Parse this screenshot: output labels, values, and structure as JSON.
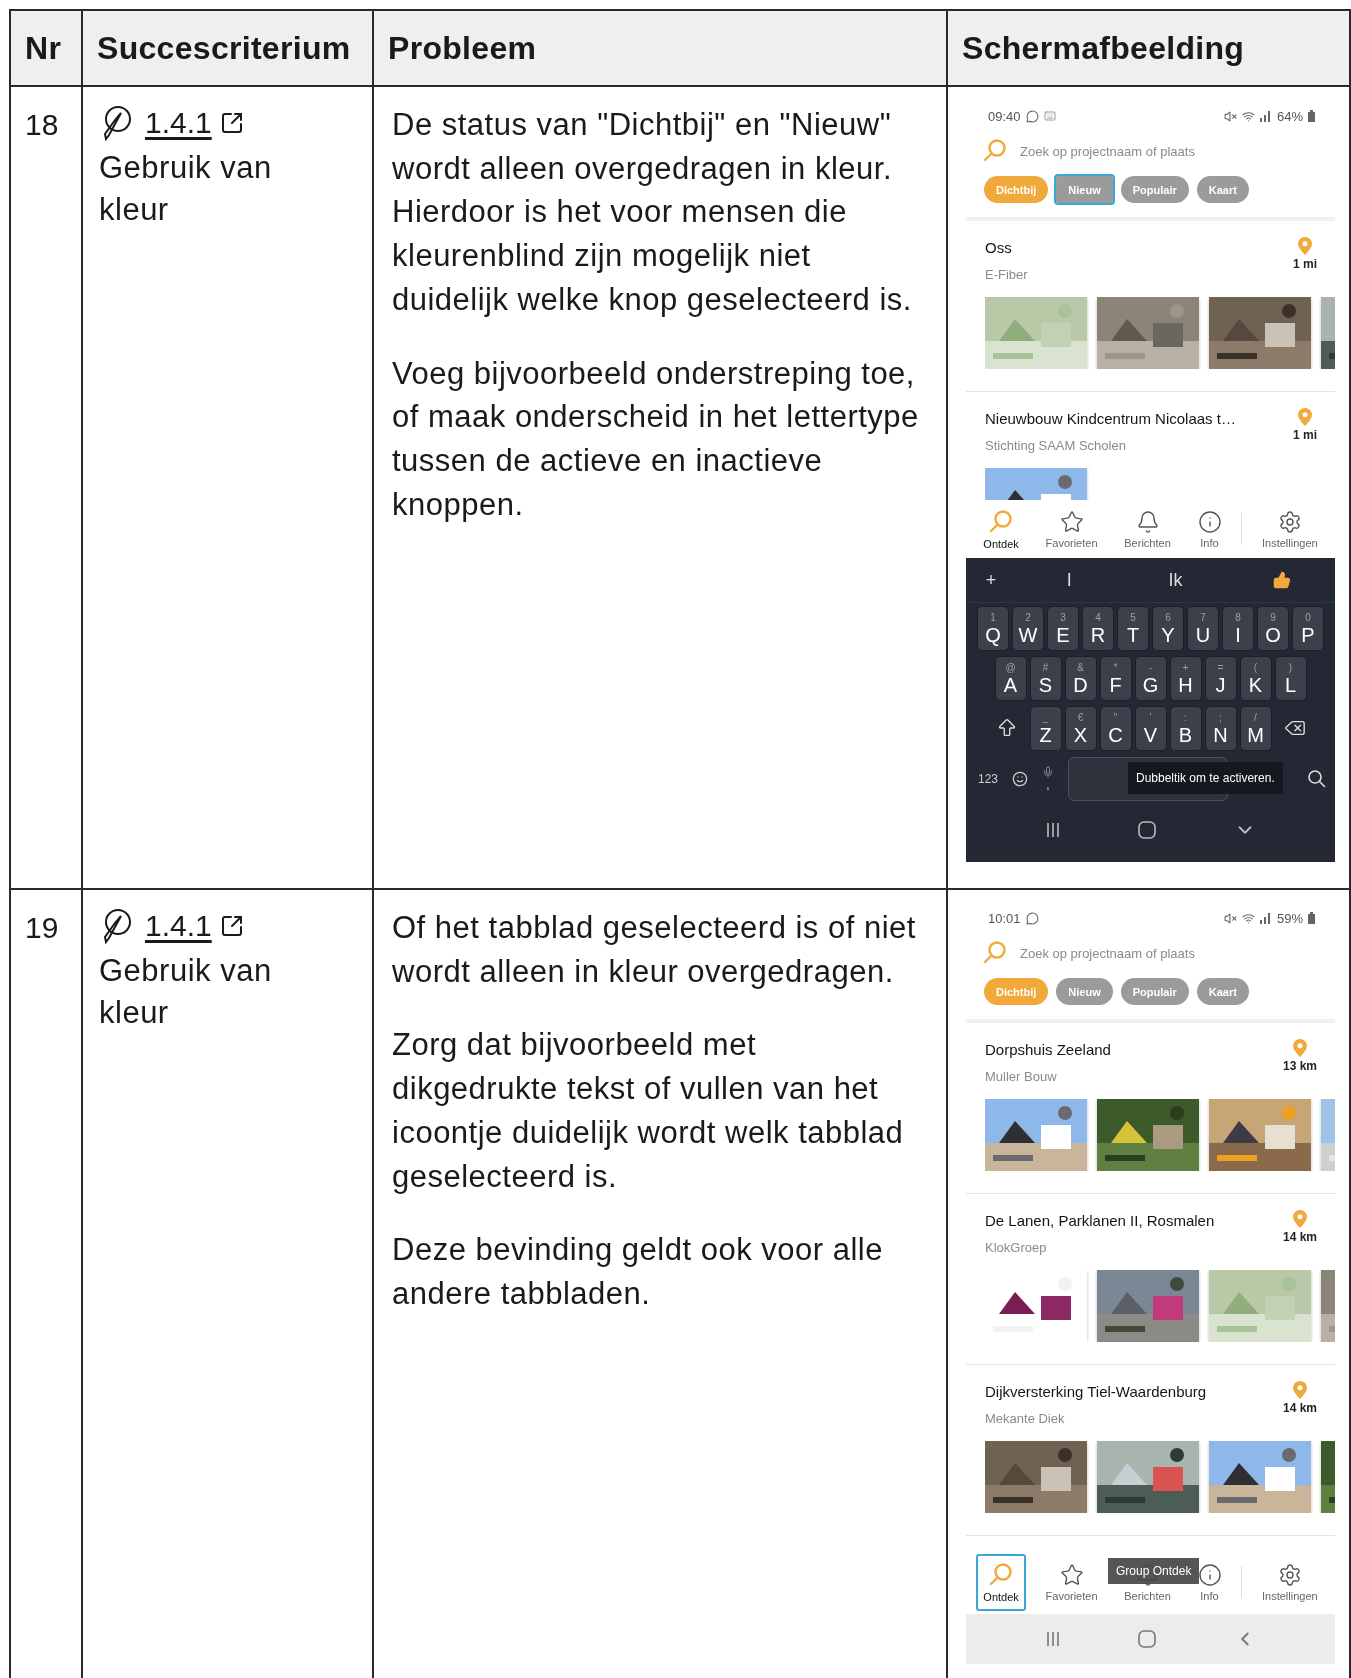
{
  "table": {
    "columns": [
      "Nr",
      "Succescriterium",
      "Probleem",
      "Schermafbeelding"
    ],
    "rows": [
      {
        "nr": "18",
        "criterion": {
          "code": "1.4.1",
          "name": "Gebruik van kleur"
        },
        "problem": [
          "De status van \"Dichtbij\" en \"Nieuw\" wordt alleen overgedragen in kleur. Hierdoor is het voor mensen die kleurenblind zijn mogelijk niet duidelijk welke knop geselecteerd is.",
          "Voeg bijvoorbeeld onderstreping toe, of maak onderscheid in het lettertype tussen de actieve en inactieve knoppen."
        ],
        "screenshot": {
          "status": {
            "time": "09:40",
            "notifications": [
              {
                "kind": "chat"
              },
              {
                "kind": "keyboard"
              }
            ],
            "battery": "64%"
          },
          "search_placeholder": "Zoek op projectnaam of plaats",
          "chips": [
            {
              "label": "Dichtbij",
              "selected": true,
              "focused": false
            },
            {
              "label": "Nieuw",
              "selected": false,
              "focused": true
            },
            {
              "label": "Populair",
              "selected": false,
              "focused": false
            },
            {
              "label": "Kaart",
              "selected": false,
              "focused": false
            }
          ],
          "cards": [
            {
              "title": "Oss",
              "subtitle": "E-Fiber",
              "distance": "1 mi"
            },
            {
              "title": "Nieuwbouw Kindcentrum Nicolaas t…",
              "subtitle": "Stichting SAAM Scholen",
              "distance": "1 mi"
            }
          ],
          "nav": [
            {
              "label": "Ontdek",
              "selected": true,
              "focused": false
            },
            {
              "label": "Favorieten",
              "selected": false,
              "focused": false
            },
            {
              "label": "Berichten",
              "selected": false,
              "focused": false
            },
            {
              "label": "Info",
              "selected": false,
              "focused": false
            },
            {
              "label": "Instellingen",
              "selected": false,
              "focused": false
            }
          ],
          "bottom": {
            "kind": "keyboard",
            "suggestions": [
              "+",
              "I",
              "Ik"
            ],
            "rows": [
              [
                {
                  "key": "Q",
                  "hint": "1"
                },
                {
                  "key": "W",
                  "hint": "2"
                },
                {
                  "key": "E",
                  "hint": "3"
                },
                {
                  "key": "R",
                  "hint": "4"
                },
                {
                  "key": "T",
                  "hint": "5"
                },
                {
                  "key": "Y",
                  "hint": "6"
                },
                {
                  "key": "U",
                  "hint": "7"
                },
                {
                  "key": "I",
                  "hint": "8"
                },
                {
                  "key": "O",
                  "hint": "9"
                },
                {
                  "key": "P",
                  "hint": "0"
                }
              ],
              [
                {
                  "key": "A",
                  "hint": "@"
                },
                {
                  "key": "S",
                  "hint": "#"
                },
                {
                  "key": "D",
                  "hint": "&"
                },
                {
                  "key": "F",
                  "hint": "*"
                },
                {
                  "key": "G",
                  "hint": "-"
                },
                {
                  "key": "H",
                  "hint": "+"
                },
                {
                  "key": "J",
                  "hint": "="
                },
                {
                  "key": "K",
                  "hint": "("
                },
                {
                  "key": "L",
                  "hint": ")"
                }
              ],
              [
                {
                  "key": "Z",
                  "hint": "_"
                },
                {
                  "key": "X",
                  "hint": "€"
                },
                {
                  "key": "C",
                  "hint": "\""
                },
                {
                  "key": "V",
                  "hint": "'"
                },
                {
                  "key": "B",
                  "hint": ":"
                },
                {
                  "key": "N",
                  "hint": ";"
                },
                {
                  "key": "M",
                  "hint": "/"
                }
              ]
            ],
            "numbers_key": "123",
            "comma_key": ",",
            "tooltip": "Dubbeltik om te activeren."
          }
        }
      },
      {
        "nr": "19",
        "criterion": {
          "code": "1.4.1",
          "name": "Gebruik van kleur"
        },
        "problem": [
          "Of het tabblad geselecteerd is of niet wordt alleen in kleur overgedragen.",
          "Zorg dat bijvoorbeeld met dikgedrukte tekst of vullen van het icoontje duidelijk wordt welk tabblad geselecteerd is.",
          "Deze bevinding geldt ook voor alle andere tabbladen."
        ],
        "screenshot": {
          "status": {
            "time": "10:01",
            "notifications": [
              {
                "kind": "chat"
              }
            ],
            "battery": "59%"
          },
          "search_placeholder": "Zoek op projectnaam of plaats",
          "chips": [
            {
              "label": "Dichtbij",
              "selected": true,
              "focused": false
            },
            {
              "label": "Nieuw",
              "selected": false,
              "focused": false
            },
            {
              "label": "Populair",
              "selected": false,
              "focused": false
            },
            {
              "label": "Kaart",
              "selected": false,
              "focused": false
            }
          ],
          "cards": [
            {
              "title": "Dorpshuis Zeeland",
              "subtitle": "Muller Bouw",
              "distance": "13 km"
            },
            {
              "title": "De Lanen, Parklanen II, Rosmalen",
              "subtitle": "KlokGroep",
              "distance": "14 km"
            },
            {
              "title": "Dijkversterking Tiel-Waardenburg",
              "subtitle": "Mekante Diek",
              "distance": "14 km"
            }
          ],
          "nav": [
            {
              "label": "Ontdek",
              "selected": true,
              "focused": true
            },
            {
              "label": "Favorieten",
              "selected": false,
              "focused": false
            },
            {
              "label": "Berichten",
              "selected": false,
              "focused": false
            },
            {
              "label": "Info",
              "selected": false,
              "focused": false
            },
            {
              "label": "Instellingen",
              "selected": false,
              "focused": false
            }
          ],
          "tooltip": "Group Ontdek",
          "bottom": {
            "kind": "system_bar"
          }
        }
      }
    ]
  }
}
